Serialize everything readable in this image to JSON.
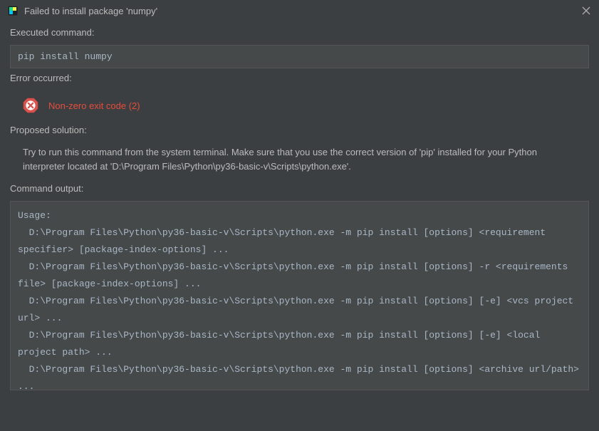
{
  "titlebar": {
    "title": "Failed to install package 'numpy'"
  },
  "sections": {
    "executed_label": "Executed command:",
    "executed_command": "pip install numpy",
    "error_label": "Error occurred:",
    "error_message": "Non-zero exit code (2)",
    "solution_label": "Proposed solution:",
    "solution_text": "Try to run this command from the system terminal. Make sure that you use the correct version of 'pip' installed for your Python interpreter located at 'D:\\Program Files\\Python\\py36-basic-v\\Scripts\\python.exe'.",
    "output_label": "Command output:",
    "command_output": "Usage:\n  D:\\Program Files\\Python\\py36-basic-v\\Scripts\\python.exe -m pip install [options] <requirement specifier> [package-index-options] ...\n  D:\\Program Files\\Python\\py36-basic-v\\Scripts\\python.exe -m pip install [options] -r <requirements file> [package-index-options] ...\n  D:\\Program Files\\Python\\py36-basic-v\\Scripts\\python.exe -m pip install [options] [-e] <vcs project url> ...\n  D:\\Program Files\\Python\\py36-basic-v\\Scripts\\python.exe -m pip install [options] [-e] <local project path> ...\n  D:\\Program Files\\Python\\py36-basic-v\\Scripts\\python.exe -m pip install [options] <archive url/path> ..."
  }
}
